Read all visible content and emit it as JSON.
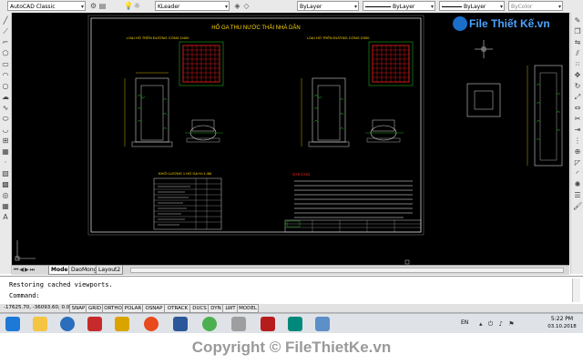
{
  "toolbar": {
    "workspace": "AutoCAD Classic",
    "layer": "KLeader",
    "color": "ByLayer",
    "linetype": "ByLayer",
    "lineweight": "ByLayer",
    "plotstyle": "ByColor"
  },
  "drawing": {
    "title": "HỐ GA THU NƯỚC THẢI NHÀ DÂN",
    "detail_left": "LOẠI HỐ TRÊN ĐƯỜNG CỐNG D400",
    "detail_right": "LOẠI HỐ TRÊN ĐƯỜNG CỐNG D300",
    "table_title": "KHỐI LƯỢNG 1 HỐ GA H=1,4M",
    "notes_title": "GHI CHÚ"
  },
  "tabs": [
    "Model",
    "DaoMong",
    "Layout2"
  ],
  "command": {
    "history": "Restoring cached viewports.",
    "prompt": "Command:"
  },
  "status": {
    "coords": "-17625.70, -36093.60, 0.00",
    "buttons": [
      "SNAP",
      "GRID",
      "ORTHO",
      "POLAR",
      "OSNAP",
      "OTRACK",
      "DUCS",
      "DYN",
      "LWT",
      "MODEL"
    ]
  },
  "taskbar": {
    "lang": "EN",
    "time": "5:22 PM",
    "date": "03.10.2018"
  },
  "watermark": {
    "logo": "File Thiết Kế.vn",
    "copyright": "Copyright © FileThietKe.vn"
  },
  "colors": {
    "drawing_bg": "#000000",
    "accent_red": "#ff2020",
    "accent_green": "#22cc22",
    "accent_yellow": "#ffd800"
  }
}
